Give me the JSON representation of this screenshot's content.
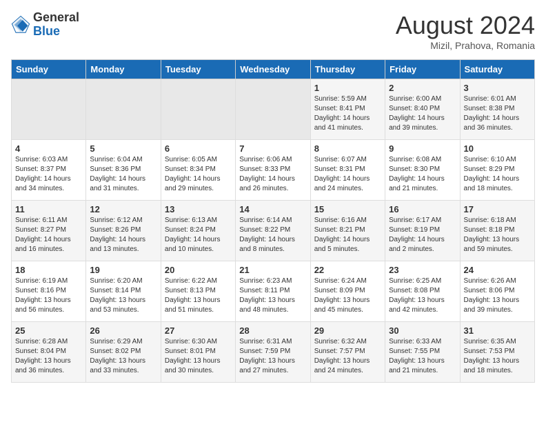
{
  "header": {
    "logo_general": "General",
    "logo_blue": "Blue",
    "month_year": "August 2024",
    "location": "Mizil, Prahova, Romania"
  },
  "weekdays": [
    "Sunday",
    "Monday",
    "Tuesday",
    "Wednesday",
    "Thursday",
    "Friday",
    "Saturday"
  ],
  "weeks": [
    [
      {
        "day": "",
        "empty": true
      },
      {
        "day": "",
        "empty": true
      },
      {
        "day": "",
        "empty": true
      },
      {
        "day": "",
        "empty": true
      },
      {
        "day": "1",
        "sunrise": "Sunrise: 5:59 AM",
        "sunset": "Sunset: 8:41 PM",
        "daylight": "Daylight: 14 hours and 41 minutes."
      },
      {
        "day": "2",
        "sunrise": "Sunrise: 6:00 AM",
        "sunset": "Sunset: 8:40 PM",
        "daylight": "Daylight: 14 hours and 39 minutes."
      },
      {
        "day": "3",
        "sunrise": "Sunrise: 6:01 AM",
        "sunset": "Sunset: 8:38 PM",
        "daylight": "Daylight: 14 hours and 36 minutes."
      }
    ],
    [
      {
        "day": "4",
        "sunrise": "Sunrise: 6:03 AM",
        "sunset": "Sunset: 8:37 PM",
        "daylight": "Daylight: 14 hours and 34 minutes."
      },
      {
        "day": "5",
        "sunrise": "Sunrise: 6:04 AM",
        "sunset": "Sunset: 8:36 PM",
        "daylight": "Daylight: 14 hours and 31 minutes."
      },
      {
        "day": "6",
        "sunrise": "Sunrise: 6:05 AM",
        "sunset": "Sunset: 8:34 PM",
        "daylight": "Daylight: 14 hours and 29 minutes."
      },
      {
        "day": "7",
        "sunrise": "Sunrise: 6:06 AM",
        "sunset": "Sunset: 8:33 PM",
        "daylight": "Daylight: 14 hours and 26 minutes."
      },
      {
        "day": "8",
        "sunrise": "Sunrise: 6:07 AM",
        "sunset": "Sunset: 8:31 PM",
        "daylight": "Daylight: 14 hours and 24 minutes."
      },
      {
        "day": "9",
        "sunrise": "Sunrise: 6:08 AM",
        "sunset": "Sunset: 8:30 PM",
        "daylight": "Daylight: 14 hours and 21 minutes."
      },
      {
        "day": "10",
        "sunrise": "Sunrise: 6:10 AM",
        "sunset": "Sunset: 8:29 PM",
        "daylight": "Daylight: 14 hours and 18 minutes."
      }
    ],
    [
      {
        "day": "11",
        "sunrise": "Sunrise: 6:11 AM",
        "sunset": "Sunset: 8:27 PM",
        "daylight": "Daylight: 14 hours and 16 minutes."
      },
      {
        "day": "12",
        "sunrise": "Sunrise: 6:12 AM",
        "sunset": "Sunset: 8:26 PM",
        "daylight": "Daylight: 14 hours and 13 minutes."
      },
      {
        "day": "13",
        "sunrise": "Sunrise: 6:13 AM",
        "sunset": "Sunset: 8:24 PM",
        "daylight": "Daylight: 14 hours and 10 minutes."
      },
      {
        "day": "14",
        "sunrise": "Sunrise: 6:14 AM",
        "sunset": "Sunset: 8:22 PM",
        "daylight": "Daylight: 14 hours and 8 minutes."
      },
      {
        "day": "15",
        "sunrise": "Sunrise: 6:16 AM",
        "sunset": "Sunset: 8:21 PM",
        "daylight": "Daylight: 14 hours and 5 minutes."
      },
      {
        "day": "16",
        "sunrise": "Sunrise: 6:17 AM",
        "sunset": "Sunset: 8:19 PM",
        "daylight": "Daylight: 14 hours and 2 minutes."
      },
      {
        "day": "17",
        "sunrise": "Sunrise: 6:18 AM",
        "sunset": "Sunset: 8:18 PM",
        "daylight": "Daylight: 13 hours and 59 minutes."
      }
    ],
    [
      {
        "day": "18",
        "sunrise": "Sunrise: 6:19 AM",
        "sunset": "Sunset: 8:16 PM",
        "daylight": "Daylight: 13 hours and 56 minutes."
      },
      {
        "day": "19",
        "sunrise": "Sunrise: 6:20 AM",
        "sunset": "Sunset: 8:14 PM",
        "daylight": "Daylight: 13 hours and 53 minutes."
      },
      {
        "day": "20",
        "sunrise": "Sunrise: 6:22 AM",
        "sunset": "Sunset: 8:13 PM",
        "daylight": "Daylight: 13 hours and 51 minutes."
      },
      {
        "day": "21",
        "sunrise": "Sunrise: 6:23 AM",
        "sunset": "Sunset: 8:11 PM",
        "daylight": "Daylight: 13 hours and 48 minutes."
      },
      {
        "day": "22",
        "sunrise": "Sunrise: 6:24 AM",
        "sunset": "Sunset: 8:09 PM",
        "daylight": "Daylight: 13 hours and 45 minutes."
      },
      {
        "day": "23",
        "sunrise": "Sunrise: 6:25 AM",
        "sunset": "Sunset: 8:08 PM",
        "daylight": "Daylight: 13 hours and 42 minutes."
      },
      {
        "day": "24",
        "sunrise": "Sunrise: 6:26 AM",
        "sunset": "Sunset: 8:06 PM",
        "daylight": "Daylight: 13 hours and 39 minutes."
      }
    ],
    [
      {
        "day": "25",
        "sunrise": "Sunrise: 6:28 AM",
        "sunset": "Sunset: 8:04 PM",
        "daylight": "Daylight: 13 hours and 36 minutes."
      },
      {
        "day": "26",
        "sunrise": "Sunrise: 6:29 AM",
        "sunset": "Sunset: 8:02 PM",
        "daylight": "Daylight: 13 hours and 33 minutes."
      },
      {
        "day": "27",
        "sunrise": "Sunrise: 6:30 AM",
        "sunset": "Sunset: 8:01 PM",
        "daylight": "Daylight: 13 hours and 30 minutes."
      },
      {
        "day": "28",
        "sunrise": "Sunrise: 6:31 AM",
        "sunset": "Sunset: 7:59 PM",
        "daylight": "Daylight: 13 hours and 27 minutes."
      },
      {
        "day": "29",
        "sunrise": "Sunrise: 6:32 AM",
        "sunset": "Sunset: 7:57 PM",
        "daylight": "Daylight: 13 hours and 24 minutes."
      },
      {
        "day": "30",
        "sunrise": "Sunrise: 6:33 AM",
        "sunset": "Sunset: 7:55 PM",
        "daylight": "Daylight: 13 hours and 21 minutes."
      },
      {
        "day": "31",
        "sunrise": "Sunrise: 6:35 AM",
        "sunset": "Sunset: 7:53 PM",
        "daylight": "Daylight: 13 hours and 18 minutes."
      }
    ]
  ]
}
